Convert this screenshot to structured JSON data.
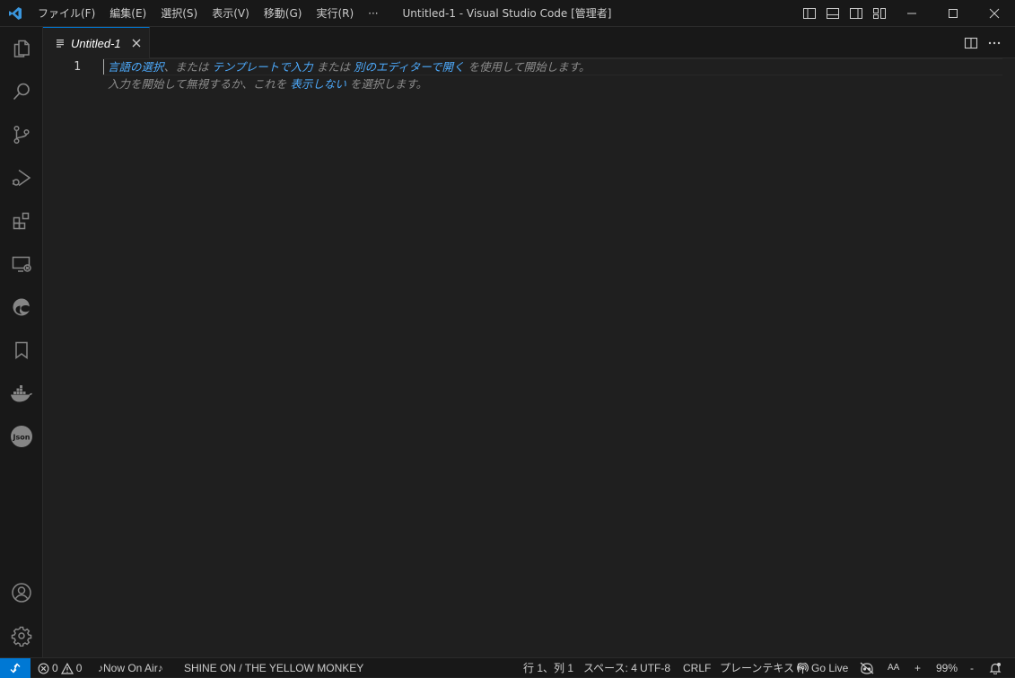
{
  "titlebar": {
    "menu": [
      "ファイル(F)",
      "編集(E)",
      "選択(S)",
      "表示(V)",
      "移動(G)",
      "実行(R)",
      "···"
    ],
    "window_title": "Untitled-1 - Visual Studio Code [管理者]"
  },
  "tabs": [
    {
      "label": "Untitled-1",
      "active": true
    }
  ],
  "editor": {
    "line_number": "1",
    "hint": {
      "select_language": "言語の選択",
      "sep1": "、または",
      "template": "テンプレートで入力",
      "or": "または",
      "open_other": "別のエディターで開く",
      "suffix": "を使用して開始します。",
      "line2_prefix": "入力を開始して無視するか、これを",
      "dont_show": "表示しない",
      "line2_suffix": "を選択します。"
    }
  },
  "statusbar": {
    "errors": "0",
    "warnings": "0",
    "now_on_air": "♪Now On Air♪",
    "song": "SHINE ON / THE YELLOW MONKEY",
    "position": "行 1、列 1",
    "indent": "スペース: 4",
    "encoding": "UTF-8",
    "eol": "CRLF",
    "language": "プレーンテキスト",
    "go_live": "Go Live",
    "font_size_label": "AA",
    "zoom_in": "+",
    "zoom": "99%",
    "zoom_out": "-"
  },
  "colors": {
    "accent": "#0078d4",
    "link": "#4daafc",
    "background": "#1f1f1f",
    "chrome": "#181818"
  }
}
